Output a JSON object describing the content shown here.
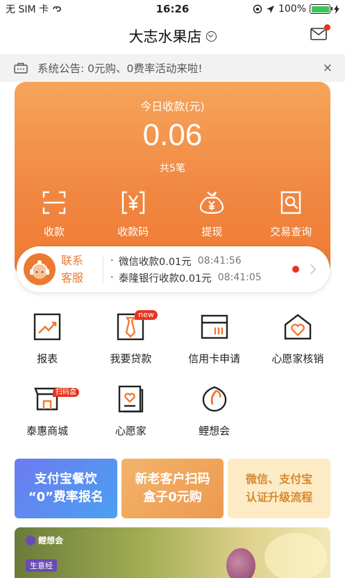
{
  "status_bar": {
    "carrier": "无 SIM 卡",
    "time": "16:26",
    "battery_percent": "100%",
    "battery_level": 1.0
  },
  "header": {
    "store_name": "大志水果店"
  },
  "notice": {
    "text": "系统公告: 0元购、0费率活动来啦!",
    "close_label": "×"
  },
  "summary": {
    "label": "今日收款(元)",
    "amount": "0.06",
    "count": "共5笔",
    "actions": [
      {
        "label": "收款",
        "icon": "scan-frame-icon"
      },
      {
        "label": "收款码",
        "icon": "yen-code-icon"
      },
      {
        "label": "提现",
        "icon": "money-bag-icon"
      },
      {
        "label": "交易查询",
        "icon": "document-search-icon"
      }
    ]
  },
  "service": {
    "label_line1": "联系",
    "label_line2": "客服",
    "feed": [
      {
        "text": "微信收款0.01元",
        "time": "08:41:56"
      },
      {
        "text": "泰隆银行收款0.01元",
        "time": "08:41:05"
      }
    ]
  },
  "grid": {
    "items": [
      {
        "label": "报表",
        "icon": "chart-trend-icon"
      },
      {
        "label": "我要贷款",
        "icon": "loan-tie-icon",
        "badge": "new"
      },
      {
        "label": "信用卡申请",
        "icon": "credit-card-icon"
      },
      {
        "label": "心愿家核销",
        "icon": "heart-house-icon"
      },
      {
        "label": "泰惠商城",
        "icon": "shop-icon",
        "badge": "扫码盒"
      },
      {
        "label": "心愿家",
        "icon": "heart-book-icon"
      },
      {
        "label": "鲤想会",
        "icon": "fish-leaf-icon"
      }
    ]
  },
  "banners": [
    {
      "line1": "支付宝餐饮",
      "line2": "“0”费率报名"
    },
    {
      "line1": "新老客户扫码",
      "line2": "盒子0元购"
    },
    {
      "line1": "微信、支付宝",
      "line2": "认证升级流程"
    }
  ],
  "promo": {
    "brand": "鲤想会",
    "tag": "生意经"
  },
  "colors": {
    "accent": "#ef7a33",
    "badge_red": "#e8341f",
    "icon_dark": "#222222"
  }
}
